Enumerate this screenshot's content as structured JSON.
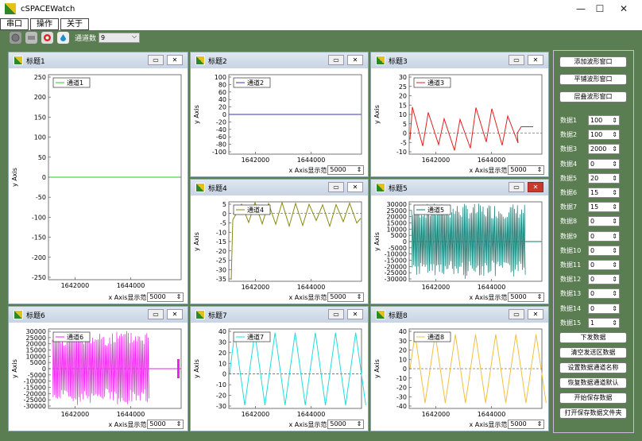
{
  "app": {
    "title": "cSPACEWatch",
    "minimize": "—",
    "maximize": "☐",
    "close": "✕"
  },
  "menu": [
    "串口",
    "操作",
    "关于"
  ],
  "toolbar": {
    "channel_label": "通道数",
    "channel_value": "9",
    "icons": [
      "port-icon",
      "settings-icon",
      "record-icon",
      "droplet-icon"
    ]
  },
  "footer": {
    "x_axis": "x Axis",
    "range_label": "显示范",
    "range_value": "5000"
  },
  "y_axis": "y Axis",
  "panels": [
    {
      "title": "标题1",
      "legend": "通道1",
      "color": "#22cc22",
      "yticks": [
        "250",
        "200",
        "150",
        "100",
        "50",
        "0",
        "-50",
        "-100",
        "-150",
        "-200",
        "-250"
      ],
      "xticks": [
        "1642000",
        "1644000"
      ]
    },
    {
      "title": "标题2",
      "legend": "通道2",
      "color": "#3333cc",
      "yticks": [
        "100",
        "80",
        "60",
        "40",
        "20",
        "0",
        "-20",
        "-40",
        "-60",
        "-80",
        "-100"
      ],
      "xticks": [
        "1642000",
        "1644000"
      ]
    },
    {
      "title": "标题3",
      "legend": "通道3",
      "color": "#dd2222",
      "yticks": [
        "30",
        "25",
        "20",
        "15",
        "10",
        "5",
        "0",
        "-5",
        "-10"
      ],
      "xticks": [
        "1642000",
        "1644000"
      ]
    },
    {
      "title": "标题4",
      "legend": "通道4",
      "color": "#8a8a10",
      "yticks": [
        "5",
        "0",
        "-5",
        "-10",
        "-15",
        "-20",
        "-25",
        "-30",
        "-35"
      ],
      "xticks": [
        "1642000",
        "1644000"
      ]
    },
    {
      "title": "标题5",
      "legend": "通道5",
      "color": "#0a7a70",
      "yticks": [
        "30000",
        "25000",
        "20000",
        "15000",
        "10000",
        "5000",
        "0",
        "-5000",
        "-10000",
        "-15000",
        "-20000",
        "-25000",
        "-30000"
      ],
      "xticks": [
        "1642000",
        "1644000"
      ]
    },
    {
      "title": "标题6",
      "legend": "通道6",
      "color": "#ee22ee",
      "yticks": [
        "30000",
        "25000",
        "20000",
        "15000",
        "10000",
        "5000",
        "0",
        "-5000",
        "-10000",
        "-15000",
        "-20000",
        "-25000",
        "-30000"
      ],
      "xticks": [
        "1642000",
        "1644000"
      ]
    },
    {
      "title": "标题7",
      "legend": "通道7",
      "color": "#22dddd",
      "yticks": [
        "40",
        "30",
        "20",
        "10",
        "0",
        "-10",
        "-20",
        "-30"
      ],
      "xticks": [
        "1642000",
        "1644000"
      ]
    },
    {
      "title": "标题8",
      "legend": "通道8",
      "color": "#f0c040",
      "yticks": [
        "40",
        "30",
        "20",
        "10",
        "0",
        "-10",
        "-20",
        "-30",
        "-40"
      ],
      "xticks": [
        "1642000",
        "1644000"
      ]
    }
  ],
  "side": {
    "top_buttons": [
      "添加波形窗口",
      "平铺波形窗口",
      "层叠波形窗口"
    ],
    "data": [
      {
        "label": "数据1",
        "value": "100"
      },
      {
        "label": "数据2",
        "value": "100"
      },
      {
        "label": "数据3",
        "value": "2000"
      },
      {
        "label": "数据4",
        "value": "0"
      },
      {
        "label": "数据5",
        "value": "20"
      },
      {
        "label": "数据6",
        "value": "15"
      },
      {
        "label": "数据7",
        "value": "15"
      },
      {
        "label": "数据8",
        "value": "0"
      },
      {
        "label": "数据9",
        "value": "0"
      },
      {
        "label": "数据10",
        "value": "0"
      },
      {
        "label": "数据11",
        "value": "0"
      },
      {
        "label": "数据12",
        "value": "0"
      },
      {
        "label": "数据13",
        "value": "0"
      },
      {
        "label": "数据14",
        "value": "0"
      },
      {
        "label": "数据15",
        "value": "1"
      }
    ],
    "bottom_buttons": [
      "下发数据",
      "清空发送区数据",
      "设置数据通道名称",
      "恢复数据通道默认",
      "开始保存数据",
      "打开保存数据文件夹"
    ]
  }
}
